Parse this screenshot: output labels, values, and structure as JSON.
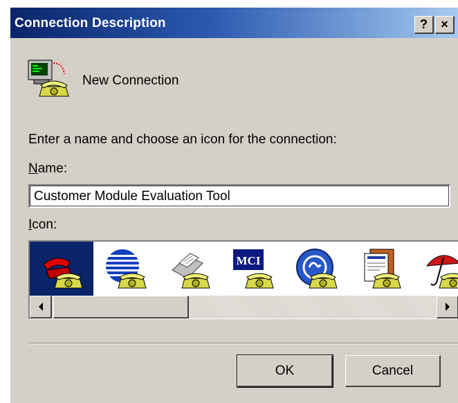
{
  "window": {
    "title": "Connection Description",
    "help_button": "?",
    "close_button": "×"
  },
  "connection": {
    "name_display": "New Connection",
    "icon": "phone-computer-icon"
  },
  "prompt": "Enter a name and choose an icon for the connection:",
  "name_field": {
    "label_accesskey": "N",
    "label_rest": "ame:",
    "value": "Customer Module Evaluation Tool"
  },
  "icon_field": {
    "label_accesskey": "I",
    "label_rest": "con:",
    "items": [
      {
        "name": "red-phone-icon",
        "selected": true
      },
      {
        "name": "globe-lines-phone-icon",
        "selected": false
      },
      {
        "name": "fax-phone-icon",
        "selected": false
      },
      {
        "name": "mci-phone-icon",
        "selected": false,
        "logo_text": "MCI"
      },
      {
        "name": "ge-globe-phone-icon",
        "selected": false
      },
      {
        "name": "documents-phone-icon",
        "selected": false
      },
      {
        "name": "umbrella-phone-icon",
        "selected": false
      }
    ]
  },
  "buttons": {
    "ok": "OK",
    "cancel": "Cancel"
  },
  "colors": {
    "title_bar_start": "#0a246a",
    "title_bar_end": "#a6caf0",
    "dialog_face": "#d4d0c8",
    "selection": "#0a246a"
  }
}
